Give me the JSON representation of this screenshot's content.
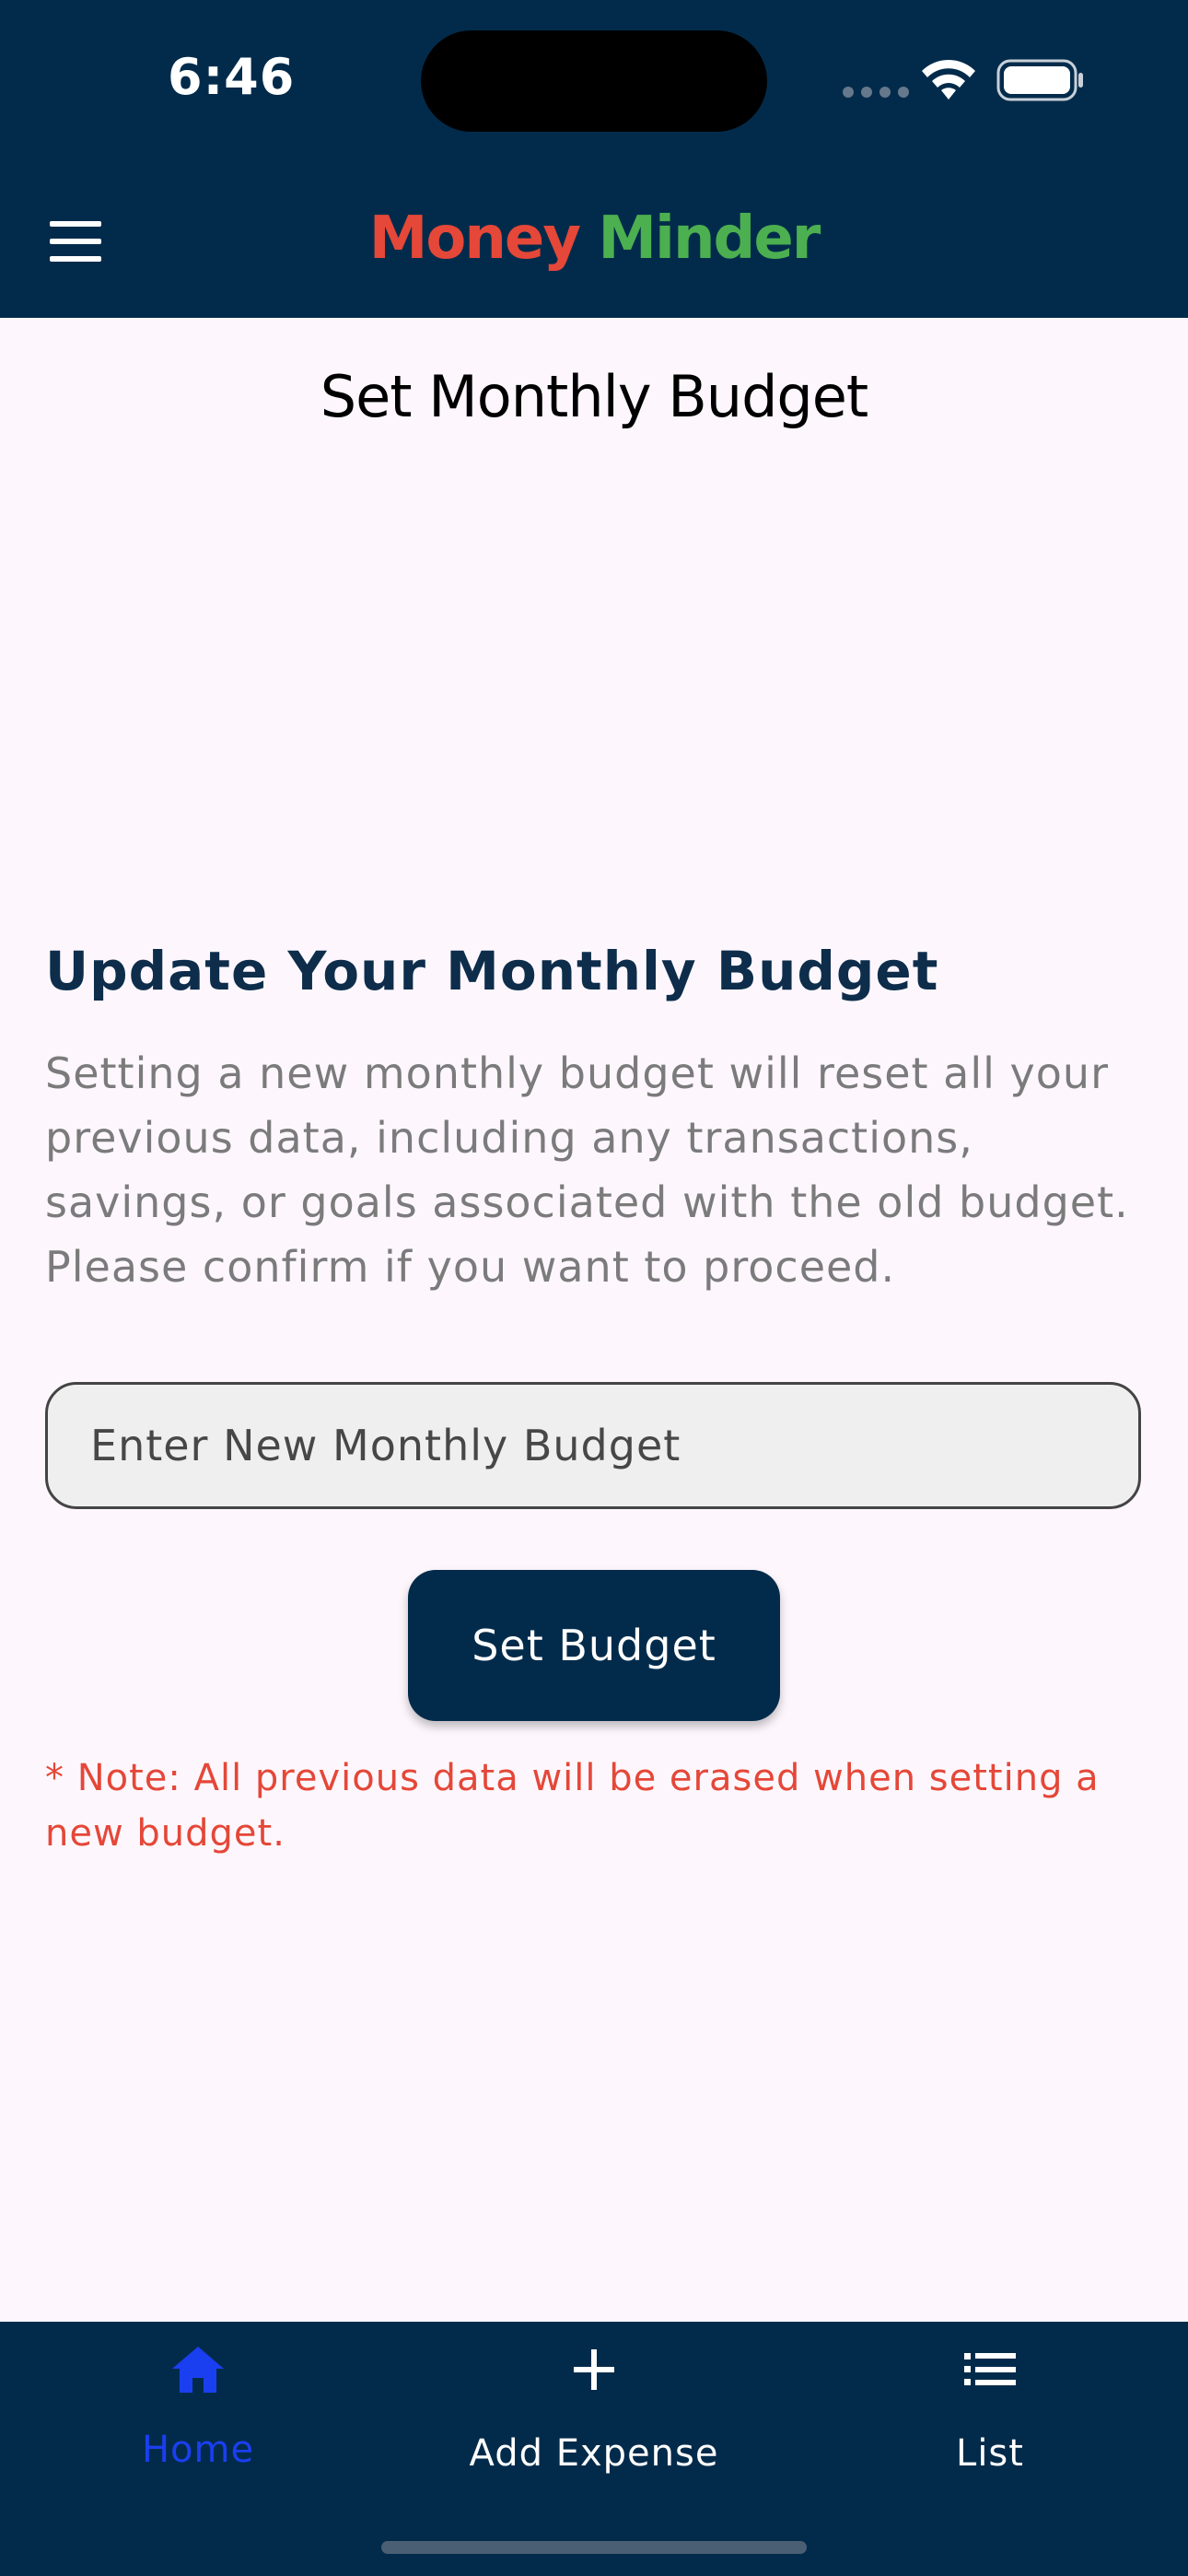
{
  "status_bar": {
    "time": "6:46"
  },
  "header": {
    "title_part1": "Money",
    "title_part2": "Minder"
  },
  "page": {
    "title": "Set Monthly Budget"
  },
  "section": {
    "heading": "Update Your Monthly Budget",
    "description": "Setting a new monthly budget will reset all your previous data, including any transactions, savings, or goals associated with the old budget. Please confirm if you want to proceed."
  },
  "budget_input": {
    "placeholder": "Enter New Monthly Budget",
    "value": ""
  },
  "set_budget_button": {
    "label": "Set Budget"
  },
  "note": {
    "text": "* Note: All previous data will be erased when setting a new budget."
  },
  "bottom_nav": {
    "items": [
      {
        "label": "Home",
        "icon": "home-icon",
        "active": true
      },
      {
        "label": "Add Expense",
        "icon": "plus-icon",
        "active": false
      },
      {
        "label": "List",
        "icon": "list-icon",
        "active": false
      }
    ]
  },
  "colors": {
    "navy": "#022b4b",
    "accent_red": "#e54738",
    "accent_green": "#4caf50",
    "active_nav": "#1a3ff0",
    "background": "#fdf7fd"
  }
}
